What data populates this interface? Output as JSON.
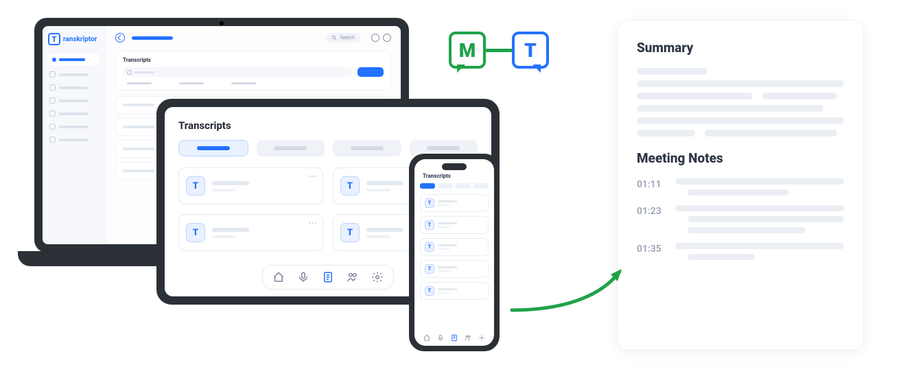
{
  "brand": {
    "name": "ranskriptor",
    "letter": "T"
  },
  "laptop": {
    "search_placeholder": "Search",
    "section_title": "Transcripts"
  },
  "tablet": {
    "title": "Transcripts",
    "icon_letter": "T"
  },
  "phone": {
    "title": "Transcripts",
    "icon_letter": "T"
  },
  "logos": {
    "m_letter": "M",
    "t_letter": "T"
  },
  "summary": {
    "heading1": "Summary",
    "heading2": "Meeting Notes",
    "notes": [
      {
        "ts": "01:11"
      },
      {
        "ts": "01:23"
      },
      {
        "ts": "01:35"
      }
    ]
  }
}
